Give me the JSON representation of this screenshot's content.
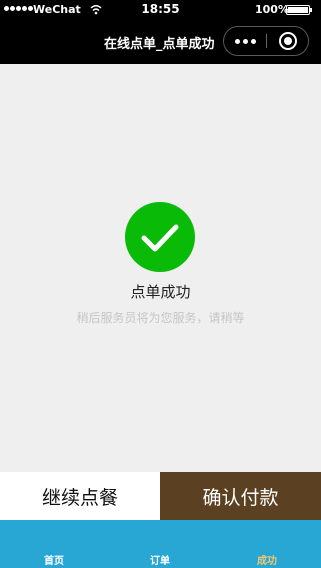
{
  "status_bar": {
    "carrier": "WeChat",
    "time": "18:55",
    "battery": "100%",
    "battery_level": 1.0
  },
  "nav": {
    "title": "在线点单_点单成功"
  },
  "success": {
    "title": "点单成功",
    "description": "稍后服务员将为您服务，请稍等",
    "icon": "check-icon",
    "icon_color": "#09bb07"
  },
  "actions": {
    "continue_label": "继续点餐",
    "pay_label": "确认付款",
    "pay_color": "#5b4121"
  },
  "tab_bar": {
    "background": "#28a7d5",
    "items": [
      {
        "label": "首页",
        "active": false
      },
      {
        "label": "订单",
        "active": false
      },
      {
        "label": "成功",
        "active": true
      }
    ],
    "active_color": "#f2c56b"
  }
}
